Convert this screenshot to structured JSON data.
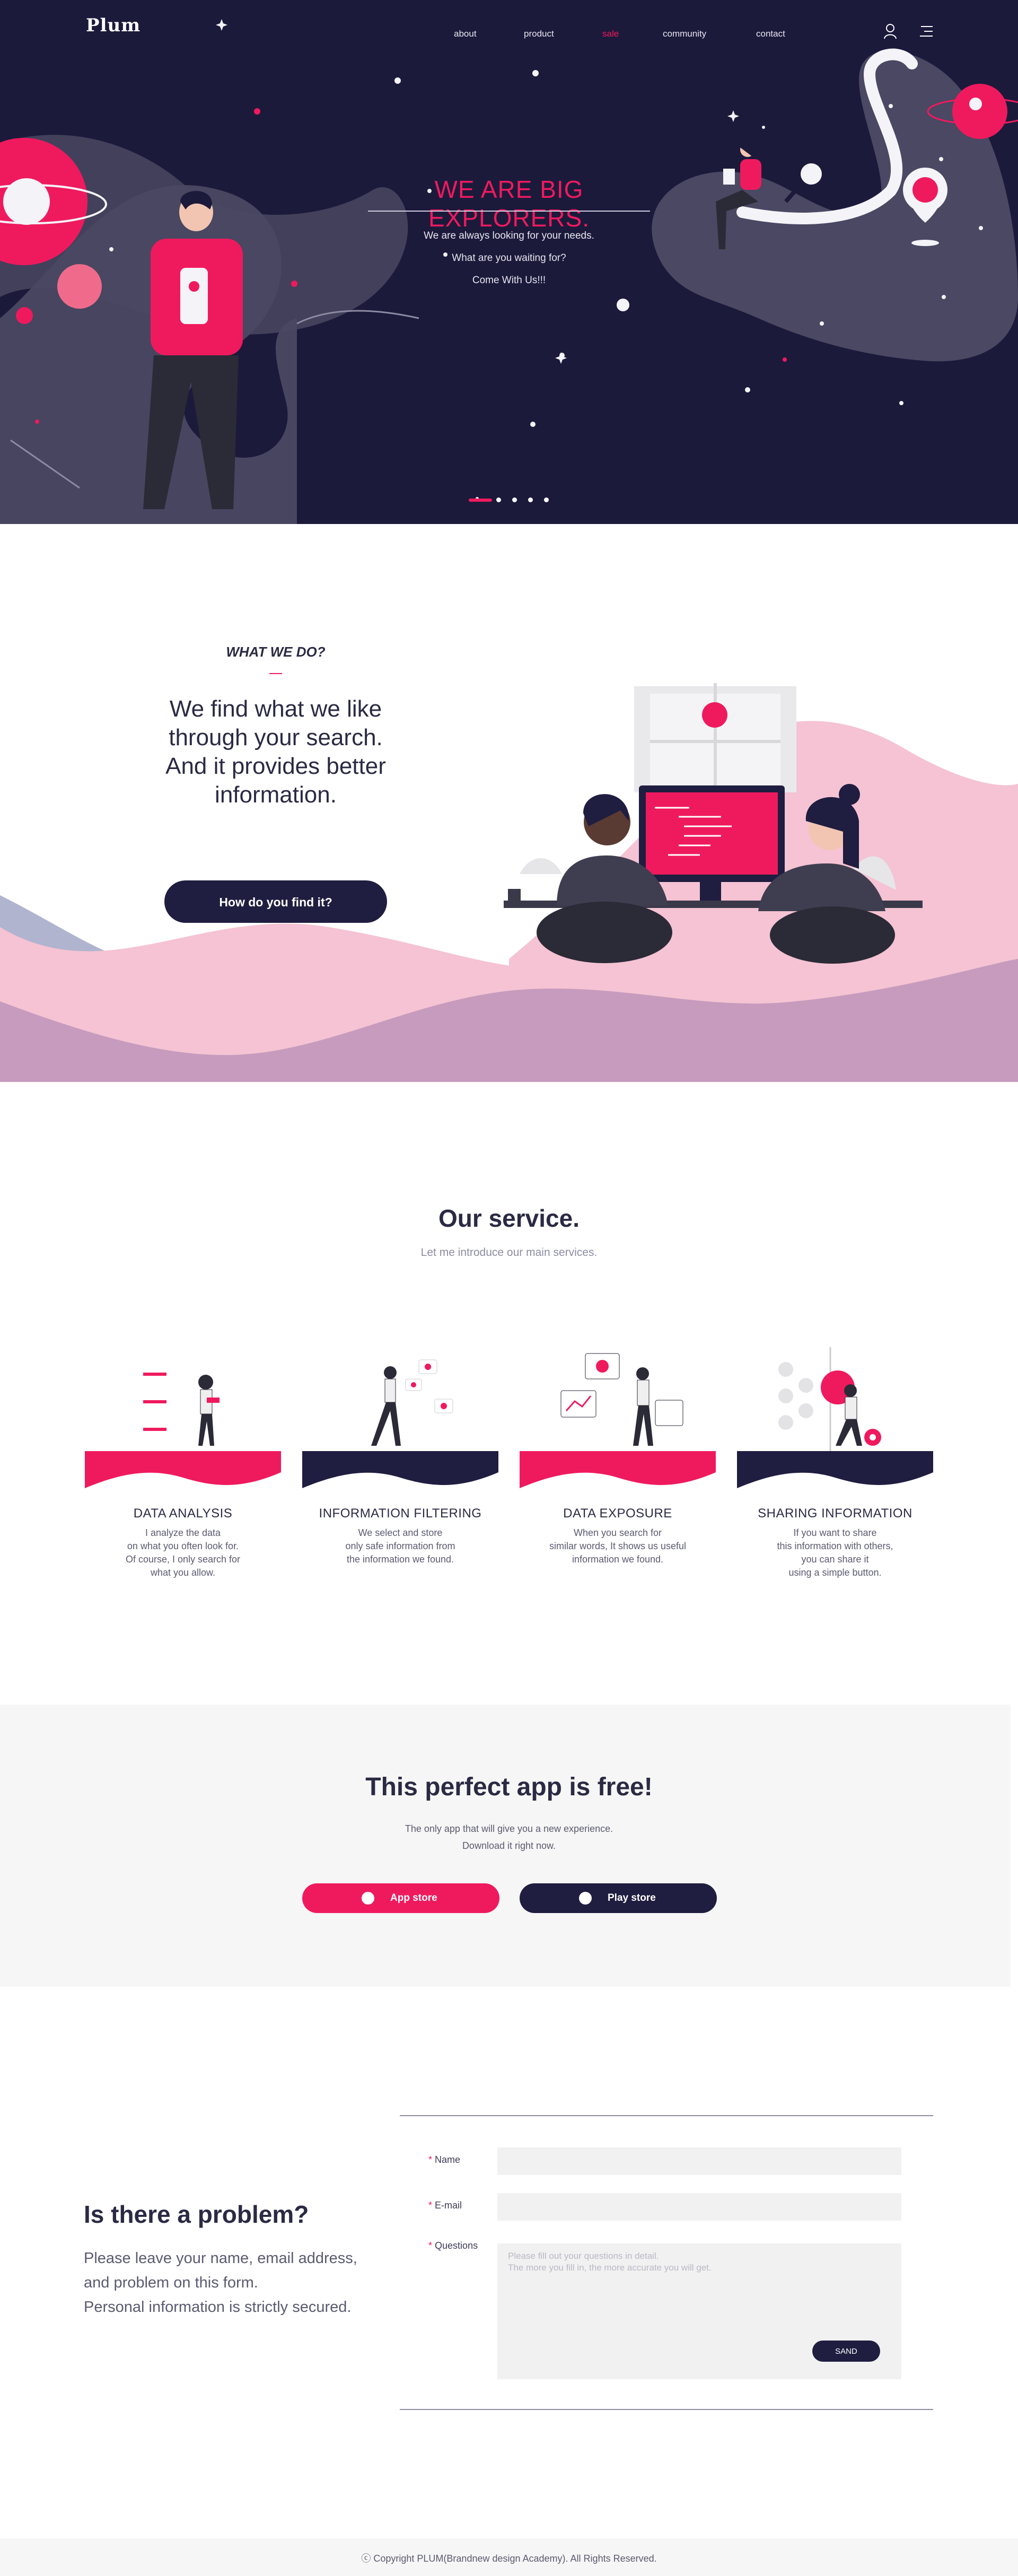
{
  "brand": {
    "logo": "Plum",
    "accent": "#ef1a5e",
    "navy": "#1f1d40"
  },
  "nav": {
    "items": [
      {
        "label": "about"
      },
      {
        "label": "product"
      },
      {
        "label": "sale",
        "active": true
      },
      {
        "label": "community"
      },
      {
        "label": "contact"
      }
    ],
    "icons": [
      "user-icon",
      "menu-icon"
    ]
  },
  "hero": {
    "title": "WE ARE BIG EXPLORERS.",
    "lines": [
      "We are always looking for your needs.",
      "What are you waiting for?",
      "Come With Us!!!"
    ],
    "slides": {
      "count": 5,
      "active": 1
    }
  },
  "what_we_do": {
    "label": "WHAT WE DO?",
    "heading": [
      "We find what we like",
      "through your search.",
      "And it provides better",
      "information."
    ],
    "button": "How do you find it?"
  },
  "service": {
    "title": "Our service.",
    "subtitle": "Let me introduce our main services.",
    "cards": [
      {
        "title": "DATA ANALYSIS",
        "desc": [
          "I analyze the data",
          "on what you often look for.",
          "Of course, I only search for",
          "what you allow."
        ]
      },
      {
        "title": "INFORMATION FILTERING",
        "desc": [
          "We select and store",
          "only safe information from",
          "the information we found."
        ]
      },
      {
        "title": "DATA EXPOSURE",
        "desc": [
          "When you search for",
          "similar words, It shows us useful",
          "information we found."
        ]
      },
      {
        "title": "SHARING INFORMATION",
        "desc": [
          "If you want to share",
          "this information with others,",
          "you can share it",
          "using a simple button."
        ]
      }
    ]
  },
  "app": {
    "title": "This perfect app is free!",
    "lines": [
      "The only app that will give you a new experience.",
      "Download it right now."
    ],
    "app_store": "App store",
    "play_store": "Play store"
  },
  "contact": {
    "title": "Is there a problem?",
    "lines": [
      "Please leave your name, email address,",
      "and problem on this form.",
      "Personal information is strictly secured."
    ],
    "fields": {
      "required_mark": "*",
      "name_label": "Name",
      "email_label": "E-mail",
      "questions_label": "Questions",
      "questions_placeholder": [
        "Please fill out your questions in detail.",
        "The more you fill in, the more accurate you will get."
      ]
    },
    "send": "SAND"
  },
  "footer": {
    "copyright": "ⓒ Copyright PLUM(Brandnew design Academy). All Rights Reserved."
  }
}
